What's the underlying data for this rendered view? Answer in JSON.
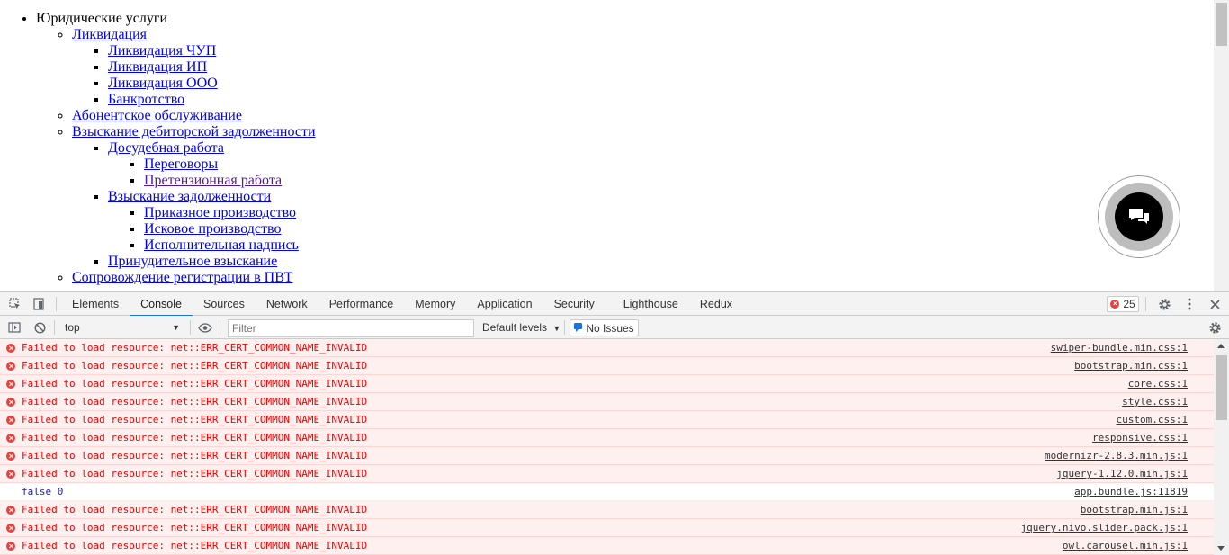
{
  "page": {
    "root_item": "Юридические услуги",
    "items": [
      {
        "label": "Ликвидация",
        "children": [
          "Ликвидация ЧУП",
          "Ликвидация ИП",
          "Ликвидация ООО",
          "Банкротство"
        ]
      },
      {
        "label": "Абонентское обслуживание"
      },
      {
        "label": "Взыскание дебиторской задолженности",
        "children": [
          {
            "label": "Досудебная работа",
            "children": [
              "Переговоры",
              "Претензионная работа"
            ]
          },
          {
            "label": "Взыскание задолженности",
            "children": [
              "Приказное производство",
              "Исковое производство",
              "Исполнительная надпись"
            ]
          },
          {
            "label": "Принудительное взыскание"
          }
        ]
      },
      {
        "label": "Сопровождение регистрации в ПВТ"
      }
    ]
  },
  "devtools": {
    "tabs": [
      "Elements",
      "Console",
      "Sources",
      "Network",
      "Performance",
      "Memory",
      "Application",
      "Security",
      "Lighthouse",
      "Redux"
    ],
    "active_tab": "Console",
    "error_count": "25",
    "toolbar": {
      "context": "top",
      "filter_placeholder": "Filter",
      "levels": "Default levels",
      "issues": "No Issues"
    },
    "messages": [
      {
        "type": "error",
        "text": "Failed to load resource: net::ERR_CERT_COMMON_NAME_INVALID",
        "source": "swiper-bundle.min.css:1"
      },
      {
        "type": "error",
        "text": "Failed to load resource: net::ERR_CERT_COMMON_NAME_INVALID",
        "source": "bootstrap.min.css:1"
      },
      {
        "type": "error",
        "text": "Failed to load resource: net::ERR_CERT_COMMON_NAME_INVALID",
        "source": "core.css:1"
      },
      {
        "type": "error",
        "text": "Failed to load resource: net::ERR_CERT_COMMON_NAME_INVALID",
        "source": "style.css:1"
      },
      {
        "type": "error",
        "text": "Failed to load resource: net::ERR_CERT_COMMON_NAME_INVALID",
        "source": "custom.css:1"
      },
      {
        "type": "error",
        "text": "Failed to load resource: net::ERR_CERT_COMMON_NAME_INVALID",
        "source": "responsive.css:1"
      },
      {
        "type": "error",
        "text": "Failed to load resource: net::ERR_CERT_COMMON_NAME_INVALID",
        "source": "modernizr-2.8.3.min.js:1"
      },
      {
        "type": "error",
        "text": "Failed to load resource: net::ERR_CERT_COMMON_NAME_INVALID",
        "source": "jquery-1.12.0.min.js:1"
      },
      {
        "type": "log",
        "text": "false 0",
        "source": "app.bundle.js:11819"
      },
      {
        "type": "error",
        "text": "Failed to load resource: net::ERR_CERT_COMMON_NAME_INVALID",
        "source": "bootstrap.min.js:1"
      },
      {
        "type": "error",
        "text": "Failed to load resource: net::ERR_CERT_COMMON_NAME_INVALID",
        "source": "jquery.nivo.slider.pack.js:1"
      },
      {
        "type": "error",
        "text": "Failed to load resource: net::ERR_CERT_COMMON_NAME_INVALID",
        "source": "owl.carousel.min.js:1"
      }
    ]
  },
  "colors": {
    "link": "#0000ee",
    "visited_link": "#551a8b",
    "error_text": "#e00000",
    "error_bg": "#fff0f0",
    "active_tab_underline": "#1a73e8"
  }
}
